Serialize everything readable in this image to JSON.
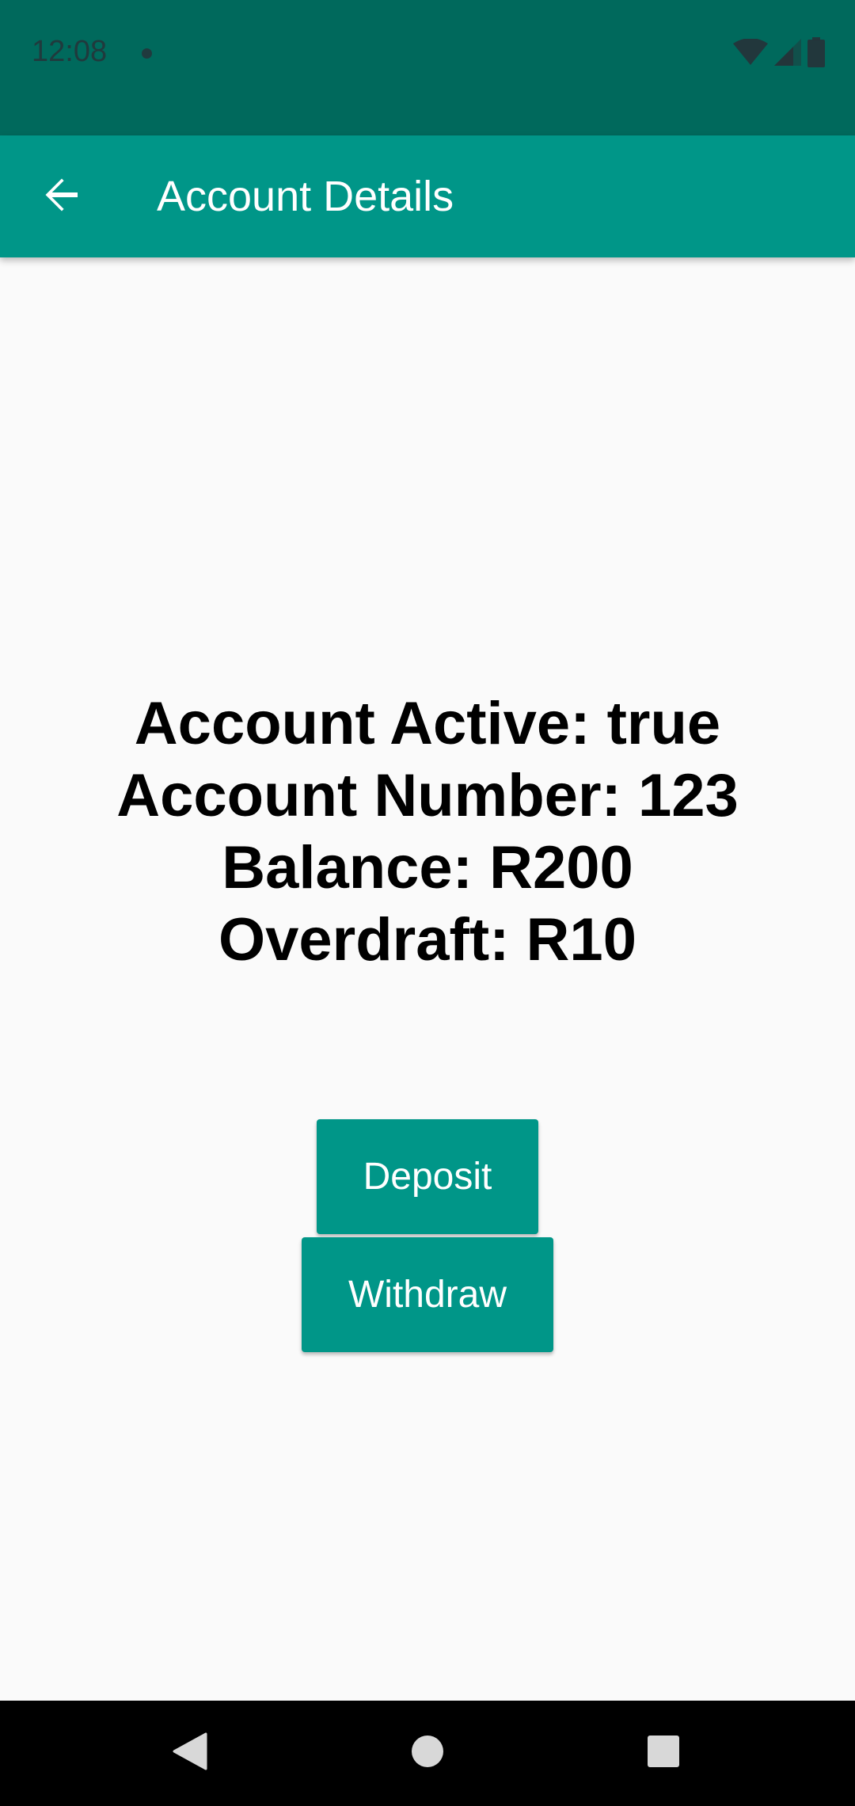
{
  "status_bar": {
    "time": "12:08",
    "icons": [
      "notification-dot-icon",
      "wifi-icon",
      "cell-signal-icon",
      "battery-icon"
    ]
  },
  "app_bar": {
    "title": "Account Details",
    "back_icon": "arrow-back-icon"
  },
  "account": {
    "active_line": "Account Active: true",
    "number_line": "Account Number: 123",
    "balance_line": "Balance: R200",
    "overdraft_line": "Overdraft: R10"
  },
  "actions": {
    "deposit_label": "Deposit",
    "withdraw_label": "Withdraw"
  },
  "nav_bar": {
    "buttons": [
      "back-triangle-icon",
      "home-circle-icon",
      "recents-square-icon"
    ]
  },
  "colors": {
    "primary": "#009688",
    "primary_dark": "#00695c",
    "background": "#fafafa"
  }
}
